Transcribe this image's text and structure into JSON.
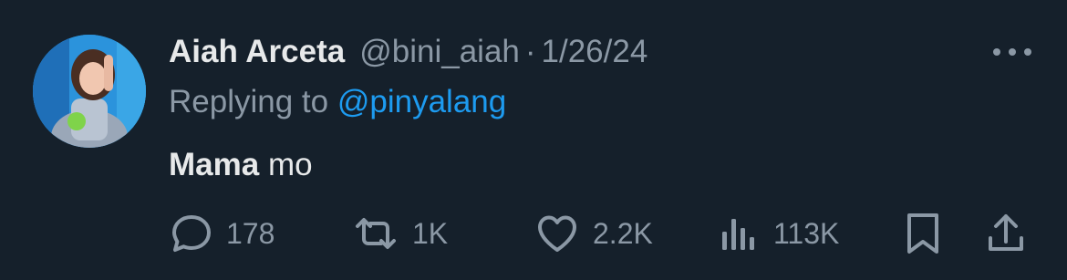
{
  "tweet": {
    "author_name": "Aiah Arceta",
    "handle": "@bini_aiah",
    "separator": "·",
    "date": "1/26/24",
    "replying_prefix": "Replying to",
    "replying_to": "@pinyalang",
    "text_bold": "Mama",
    "text_rest": " mo"
  },
  "actions": {
    "replies": "178",
    "retweets": "1K",
    "likes": "2.2K",
    "views": "113K"
  },
  "icons": {
    "more": "more-horizontal-icon",
    "reply": "comment-bubble-icon",
    "retweet": "retweet-icon",
    "like": "heart-icon",
    "views": "bar-chart-icon",
    "bookmark": "bookmark-icon",
    "share": "share-upload-icon"
  },
  "colors": {
    "background": "#15202b",
    "primary_text": "#e7e9ea",
    "secondary_text": "#8b98a5",
    "link": "#1d9bf0"
  }
}
